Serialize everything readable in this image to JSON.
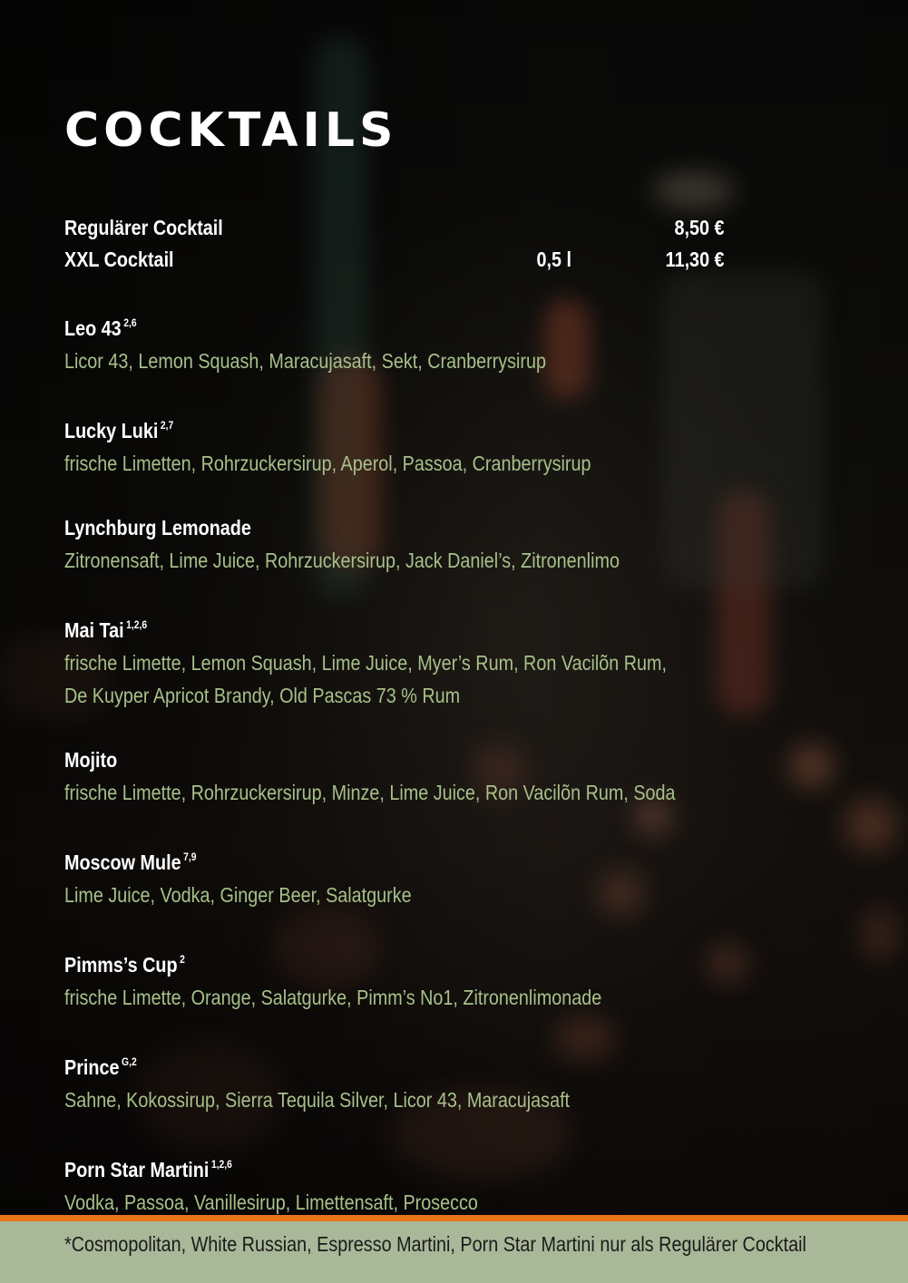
{
  "title": "COCKTAILS",
  "prices": [
    {
      "name": "Regulärer Cocktail",
      "size": "",
      "price": "8,50 €"
    },
    {
      "name": "XXL Cocktail",
      "size": "0,5 l",
      "price": "11,30 €"
    }
  ],
  "items": [
    {
      "name": "Leo 43",
      "sup": "2,6",
      "desc": [
        "Licor 43, Lemon Squash, Maracujasaft, Sekt, Cranberrysirup"
      ]
    },
    {
      "name": "Lucky Luki",
      "sup": "2,7",
      "desc": [
        "frische Limetten, Rohrzuckersirup, Aperol, Passoa, Cranberrysirup"
      ]
    },
    {
      "name": "Lynchburg Lemonade",
      "sup": "",
      "desc": [
        "Zitronensaft, Lime Juice, Rohrzuckersirup, Jack Daniel’s, Zitronenlimo"
      ]
    },
    {
      "name": "Mai Tai",
      "sup": "1,2,6",
      "desc": [
        "frische Limette, Lemon Squash, Lime Juice, Myer’s Rum, Ron Vacilõn Rum,",
        "De Kuyper Apricot Brandy, Old Pascas 73 % Rum"
      ]
    },
    {
      "name": "Mojito",
      "sup": "",
      "desc": [
        "frische Limette, Rohrzuckersirup, Minze, Lime Juice, Ron Vacilõn Rum, Soda"
      ]
    },
    {
      "name": "Moscow Mule",
      "sup": "7,9",
      "desc": [
        "Lime Juice, Vodka, Ginger Beer, Salatgurke"
      ]
    },
    {
      "name": "Pimms’s Cup",
      "sup": "2",
      "desc": [
        "frische Limette, Orange, Salatgurke, Pimm’s No1, Zitronenlimonade"
      ]
    },
    {
      "name": "Prince",
      "sup": "G,2",
      "desc": [
        "Sahne, Kokossirup, Sierra Tequila Silver, Licor 43, Maracujasaft"
      ]
    },
    {
      "name": "Porn Star Martini",
      "sup": "1,2,6",
      "desc": [
        "Vodka, Passoa, Vanillesirup, Limettensaft, Prosecco"
      ]
    }
  ],
  "footer": {
    "note": "*Cosmopolitan, White Russian, Espresso Martini, Porn Star  Martini nur als Regulärer Cocktail"
  },
  "colors": {
    "ingredient_text": "#a7c08a",
    "footer_background": "#a9b898",
    "footer_rule": "#e8771c"
  }
}
